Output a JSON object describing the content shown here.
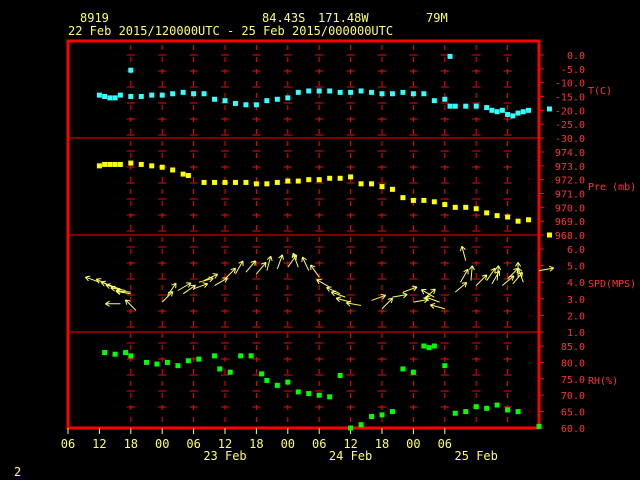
{
  "header": {
    "station": "8919",
    "lat": "84.43S",
    "lon": "171.48W",
    "elev": "79M",
    "range": "22 Feb 2015/120000UTC - 25 Feb 2015/000000UTC"
  },
  "footer": {
    "page_number": "2"
  },
  "colors": {
    "temp": "#33ffff",
    "pres": "#ffff00",
    "wind": "#ffff66",
    "rh": "#00ff00",
    "frame": "#ff0000",
    "text": "#ffff66"
  },
  "chart_data": {
    "type": "scatter",
    "x_axis": {
      "unit": "hours",
      "range": [
        -6,
        84
      ],
      "tick_labels": [
        "06",
        "12",
        "18",
        "00",
        "06",
        "12",
        "18",
        "00",
        "06",
        "12",
        "18",
        "00",
        "06"
      ],
      "day_labels": [
        {
          "text": "23 Feb",
          "x": 24
        },
        {
          "text": "24 Feb",
          "x": 48
        },
        {
          "text": "25 Feb",
          "x": 72
        }
      ]
    },
    "panels": [
      {
        "name": "T(C)",
        "ticks": [
          "0.0",
          "-5.0",
          "-10.0",
          "-15.0",
          "-20.0",
          "-25.0",
          "-30.0"
        ],
        "ylim": [
          -30,
          0
        ],
        "points": [
          [
            0,
            -14.5
          ],
          [
            1,
            -15
          ],
          [
            2,
            -15.5
          ],
          [
            3,
            -15.5
          ],
          [
            4,
            -14.5
          ],
          [
            6,
            -5.5
          ],
          [
            6,
            -15
          ],
          [
            8,
            -15
          ],
          [
            10,
            -14.5
          ],
          [
            12,
            -14.5
          ],
          [
            14,
            -14
          ],
          [
            16,
            -13.5
          ],
          [
            18,
            -14
          ],
          [
            20,
            -14
          ],
          [
            22,
            -16
          ],
          [
            24,
            -16.5
          ],
          [
            26,
            -17.5
          ],
          [
            28,
            -18
          ],
          [
            30,
            -18
          ],
          [
            32,
            -16.5
          ],
          [
            34,
            -16
          ],
          [
            36,
            -15.5
          ],
          [
            38,
            -13.5
          ],
          [
            40,
            -13
          ],
          [
            42,
            -13
          ],
          [
            44,
            -13
          ],
          [
            46,
            -13.5
          ],
          [
            48,
            -13.5
          ],
          [
            50,
            -13
          ],
          [
            52,
            -13.5
          ],
          [
            54,
            -14
          ],
          [
            56,
            -14
          ],
          [
            58,
            -13.5
          ],
          [
            60,
            -14
          ],
          [
            62,
            -14
          ],
          [
            64,
            -16.5
          ],
          [
            66,
            -16
          ],
          [
            67,
            -0.5
          ],
          [
            67,
            -18.5
          ],
          [
            68,
            -18.5
          ],
          [
            70,
            -18.5
          ],
          [
            72,
            -18.5
          ],
          [
            74,
            -19
          ],
          [
            75,
            -20
          ],
          [
            76,
            -20.5
          ],
          [
            77,
            -20
          ],
          [
            78,
            -21.5
          ],
          [
            79,
            -22
          ],
          [
            80,
            -21
          ],
          [
            81,
            -20.5
          ],
          [
            82,
            -20
          ],
          [
            86,
            -19.5
          ]
        ]
      },
      {
        "name": "Pre (mb)",
        "ticks": [
          "974.0",
          "973.0",
          "972.0",
          "971.0",
          "970.0",
          "969.0",
          "968.0"
        ],
        "ylim": [
          968,
          974
        ],
        "points": [
          [
            0,
            973.0
          ],
          [
            1,
            973.1
          ],
          [
            2,
            973.1
          ],
          [
            3,
            973.1
          ],
          [
            4,
            973.1
          ],
          [
            6,
            973.2
          ],
          [
            8,
            973.1
          ],
          [
            10,
            973.0
          ],
          [
            12,
            972.9
          ],
          [
            14,
            972.7
          ],
          [
            16,
            972.4
          ],
          [
            17,
            972.3
          ],
          [
            20,
            971.8
          ],
          [
            22,
            971.8
          ],
          [
            24,
            971.8
          ],
          [
            26,
            971.8
          ],
          [
            28,
            971.8
          ],
          [
            30,
            971.7
          ],
          [
            32,
            971.7
          ],
          [
            34,
            971.8
          ],
          [
            36,
            971.9
          ],
          [
            38,
            971.9
          ],
          [
            40,
            972.0
          ],
          [
            42,
            972.0
          ],
          [
            44,
            972.1
          ],
          [
            46,
            972.1
          ],
          [
            48,
            972.2
          ],
          [
            50,
            971.7
          ],
          [
            52,
            971.7
          ],
          [
            54,
            971.5
          ],
          [
            56,
            971.3
          ],
          [
            58,
            970.7
          ],
          [
            60,
            970.5
          ],
          [
            62,
            970.5
          ],
          [
            64,
            970.4
          ],
          [
            66,
            970.2
          ],
          [
            68,
            970.0
          ],
          [
            70,
            970.0
          ],
          [
            72,
            969.9
          ],
          [
            74,
            969.6
          ],
          [
            76,
            969.4
          ],
          [
            78,
            969.3
          ],
          [
            80,
            969.0
          ],
          [
            82,
            969.1
          ],
          [
            86,
            968.0
          ]
        ]
      },
      {
        "name": "SPD(MPS)",
        "ticks": [
          "6.0",
          "5.0",
          "4.0",
          "3.0",
          "2.0",
          "1.0"
        ],
        "ylim": [
          1,
          6
        ],
        "winds": [
          [
            0,
            4.0,
            160
          ],
          [
            2,
            3.8,
            155
          ],
          [
            3,
            3.7,
            160
          ],
          [
            4,
            3.6,
            165
          ],
          [
            5,
            3.5,
            170
          ],
          [
            6,
            3.4,
            175
          ],
          [
            6,
            3.3,
            170
          ],
          [
            4,
            2.7,
            180
          ],
          [
            7,
            2.3,
            135
          ],
          [
            12,
            2.8,
            45
          ],
          [
            13,
            3.2,
            55
          ],
          [
            15,
            3.5,
            30
          ],
          [
            16,
            3.3,
            35
          ],
          [
            18,
            3.6,
            20
          ],
          [
            19,
            4.0,
            15
          ],
          [
            20,
            4.1,
            25
          ],
          [
            22,
            3.8,
            30
          ],
          [
            24,
            4.2,
            45
          ],
          [
            26,
            4.5,
            60
          ],
          [
            28,
            4.6,
            50
          ],
          [
            30,
            4.5,
            50
          ],
          [
            32,
            4.7,
            75
          ],
          [
            34,
            4.8,
            70
          ],
          [
            36,
            4.9,
            55
          ],
          [
            38,
            4.9,
            110
          ],
          [
            40,
            4.7,
            115
          ],
          [
            42,
            4.3,
            125
          ],
          [
            44,
            3.7,
            150
          ],
          [
            46,
            3.3,
            155
          ],
          [
            47,
            3.1,
            160
          ],
          [
            48,
            2.8,
            165
          ],
          [
            50,
            2.6,
            170
          ],
          [
            52,
            2.9,
            20
          ],
          [
            54,
            2.4,
            45
          ],
          [
            56,
            3.1,
            10
          ],
          [
            58,
            3.4,
            20
          ],
          [
            60,
            2.8,
            10
          ],
          [
            62,
            3.0,
            40
          ],
          [
            64,
            3.1,
            150
          ],
          [
            65,
            2.8,
            160
          ],
          [
            66,
            2.4,
            165
          ],
          [
            68,
            3.4,
            40
          ],
          [
            69,
            4.0,
            60
          ],
          [
            70,
            5.3,
            105
          ],
          [
            71,
            4.1,
            85
          ],
          [
            72,
            3.8,
            45
          ],
          [
            74,
            4.1,
            55
          ],
          [
            75,
            3.9,
            60
          ],
          [
            76,
            4.1,
            85
          ],
          [
            77,
            3.8,
            40
          ],
          [
            78,
            4.2,
            45
          ],
          [
            79,
            3.9,
            50
          ],
          [
            80,
            4.3,
            90
          ],
          [
            81,
            4.0,
            110
          ],
          [
            84,
            4.7,
            10
          ]
        ]
      },
      {
        "name": "RH(%)",
        "ticks": [
          "85.0",
          "80.0",
          "75.0",
          "70.0",
          "65.0",
          "60.0"
        ],
        "ylim": [
          60,
          85
        ],
        "points": [
          [
            1,
            83
          ],
          [
            3,
            82.5
          ],
          [
            5,
            83
          ],
          [
            6,
            82
          ],
          [
            9,
            80
          ],
          [
            11,
            79.5
          ],
          [
            13,
            80
          ],
          [
            15,
            79
          ],
          [
            17,
            80.5
          ],
          [
            19,
            81
          ],
          [
            22,
            82
          ],
          [
            23,
            78
          ],
          [
            25,
            77
          ],
          [
            27,
            82
          ],
          [
            29,
            82
          ],
          [
            31,
            76.5
          ],
          [
            32,
            74.5
          ],
          [
            34,
            73
          ],
          [
            36,
            74
          ],
          [
            38,
            71
          ],
          [
            40,
            70.5
          ],
          [
            42,
            70
          ],
          [
            44,
            69.5
          ],
          [
            46,
            76
          ],
          [
            48,
            60
          ],
          [
            50,
            61
          ],
          [
            52,
            63.5
          ],
          [
            54,
            64
          ],
          [
            56,
            65
          ],
          [
            58,
            78
          ],
          [
            60,
            77
          ],
          [
            62,
            85
          ],
          [
            63,
            84.5
          ],
          [
            64,
            85
          ],
          [
            66,
            79
          ],
          [
            68,
            64.5
          ],
          [
            70,
            65
          ],
          [
            72,
            66.5
          ],
          [
            74,
            66
          ],
          [
            76,
            67
          ],
          [
            78,
            65.5
          ],
          [
            80,
            65
          ],
          [
            84,
            60.5
          ]
        ]
      }
    ]
  }
}
